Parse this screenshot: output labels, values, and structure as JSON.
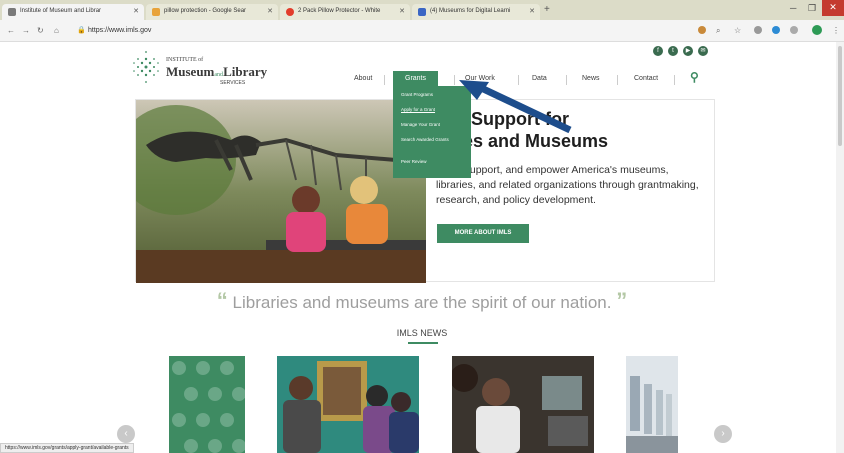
{
  "browser": {
    "tabs": [
      {
        "label": "Institute of Museum and Librar",
        "fav_color": "#7a7a7a"
      },
      {
        "label": "pillow protection - Google Sear",
        "fav_color": "#e8a33a"
      },
      {
        "label": "2 Pack Pillow Protector - White",
        "fav_color": "#e23c2b"
      },
      {
        "label": "(4) Museums for Digital Learni",
        "fav_color": "#3b66c4"
      }
    ],
    "url": "https://www.imls.gov",
    "win_buttons": [
      "─",
      "❐",
      "✕"
    ]
  },
  "site": {
    "logo": {
      "line1": "INSTITUTE of",
      "museum": "Museum",
      "and": "and",
      "library": "Library",
      "services": "SERVICES"
    },
    "social": [
      "f",
      "t",
      "▶",
      "✉"
    ],
    "nav": [
      "About",
      "Grants",
      "Our Work",
      "Data",
      "News",
      "Contact"
    ],
    "grants_menu": [
      "Grant Programs",
      "Apply for a Grant",
      "Manage Your Grant",
      "Search Awarded Grants",
      "Peer Review"
    ]
  },
  "hero": {
    "title": "eral Support for\nraries and Museums",
    "body": "ance, support, and empower America's museums, libraries, and related organizations through grantmaking, research, and policy development.",
    "button": "MORE ABOUT IMLS"
  },
  "quote": {
    "open": "“",
    "text": "Libraries and museums are the spirit of our nation.",
    "close": "”"
  },
  "news": {
    "heading": "IMLS NEWS"
  },
  "status_bar": "https://www.imls.gov/grants/apply-grant/available-grants",
  "colors": {
    "brand_green": "#3e8b62",
    "arrow_blue": "#1d4d8c"
  }
}
